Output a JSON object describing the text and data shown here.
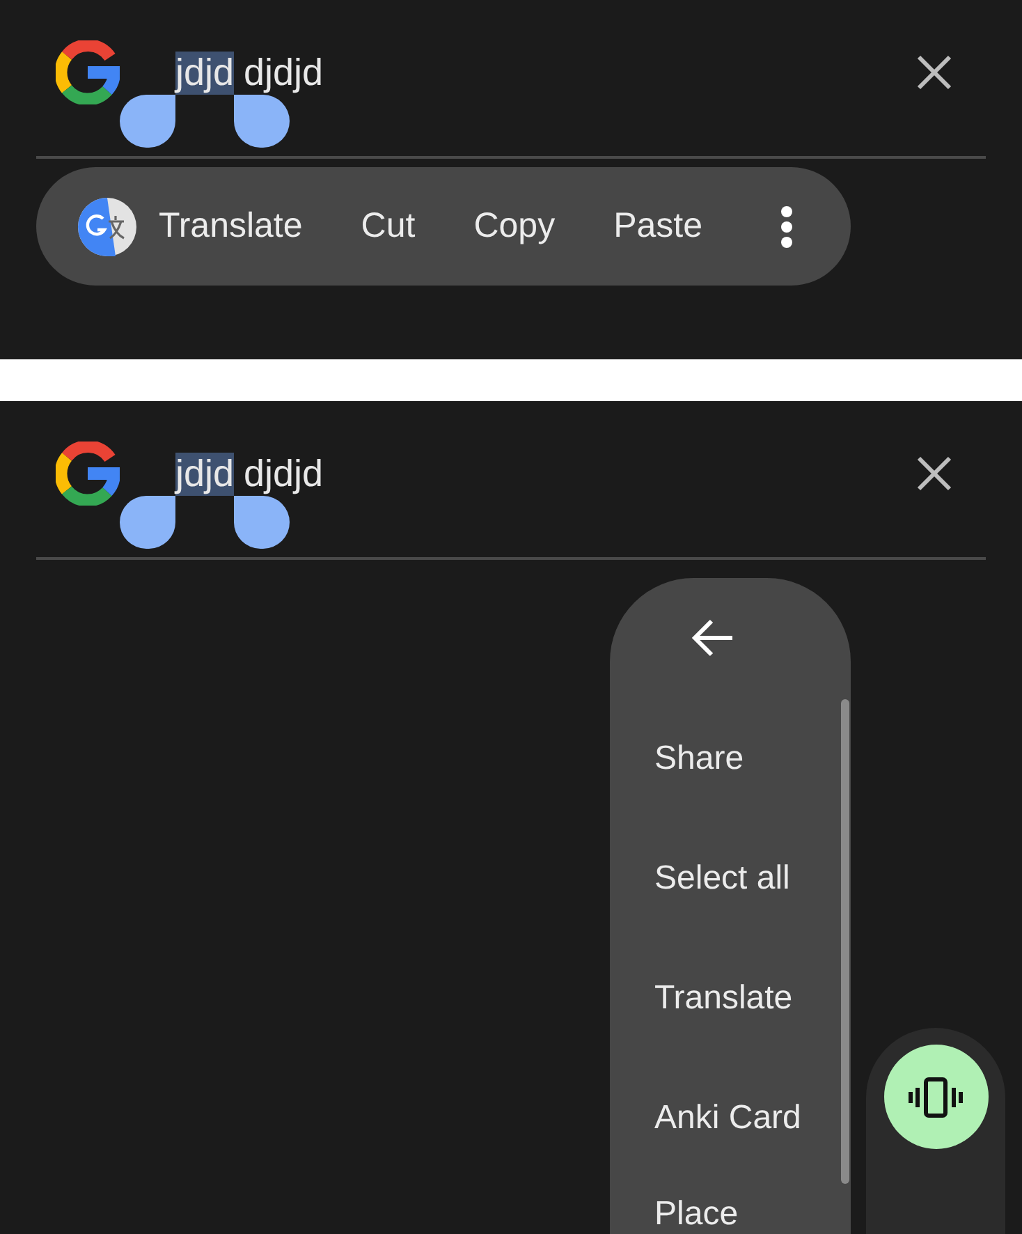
{
  "panels": [
    {
      "kind": "toolbar",
      "query": {
        "selected_text": "jdjd",
        "rest_text": "djdjd"
      },
      "toolbar": {
        "items": [
          {
            "kind": "translate",
            "label": "Translate"
          },
          {
            "kind": "text",
            "label": "Cut"
          },
          {
            "kind": "text",
            "label": "Copy"
          },
          {
            "kind": "text",
            "label": "Paste"
          },
          {
            "kind": "overflow"
          }
        ]
      }
    },
    {
      "kind": "menu",
      "query": {
        "selected_text": "jdjd",
        "rest_text": "djdjd"
      },
      "menu": {
        "items": [
          "Share",
          "Select all",
          "Translate",
          "Anki Card",
          "Place"
        ]
      },
      "fab": {
        "kind": "vibrate"
      }
    }
  ]
}
